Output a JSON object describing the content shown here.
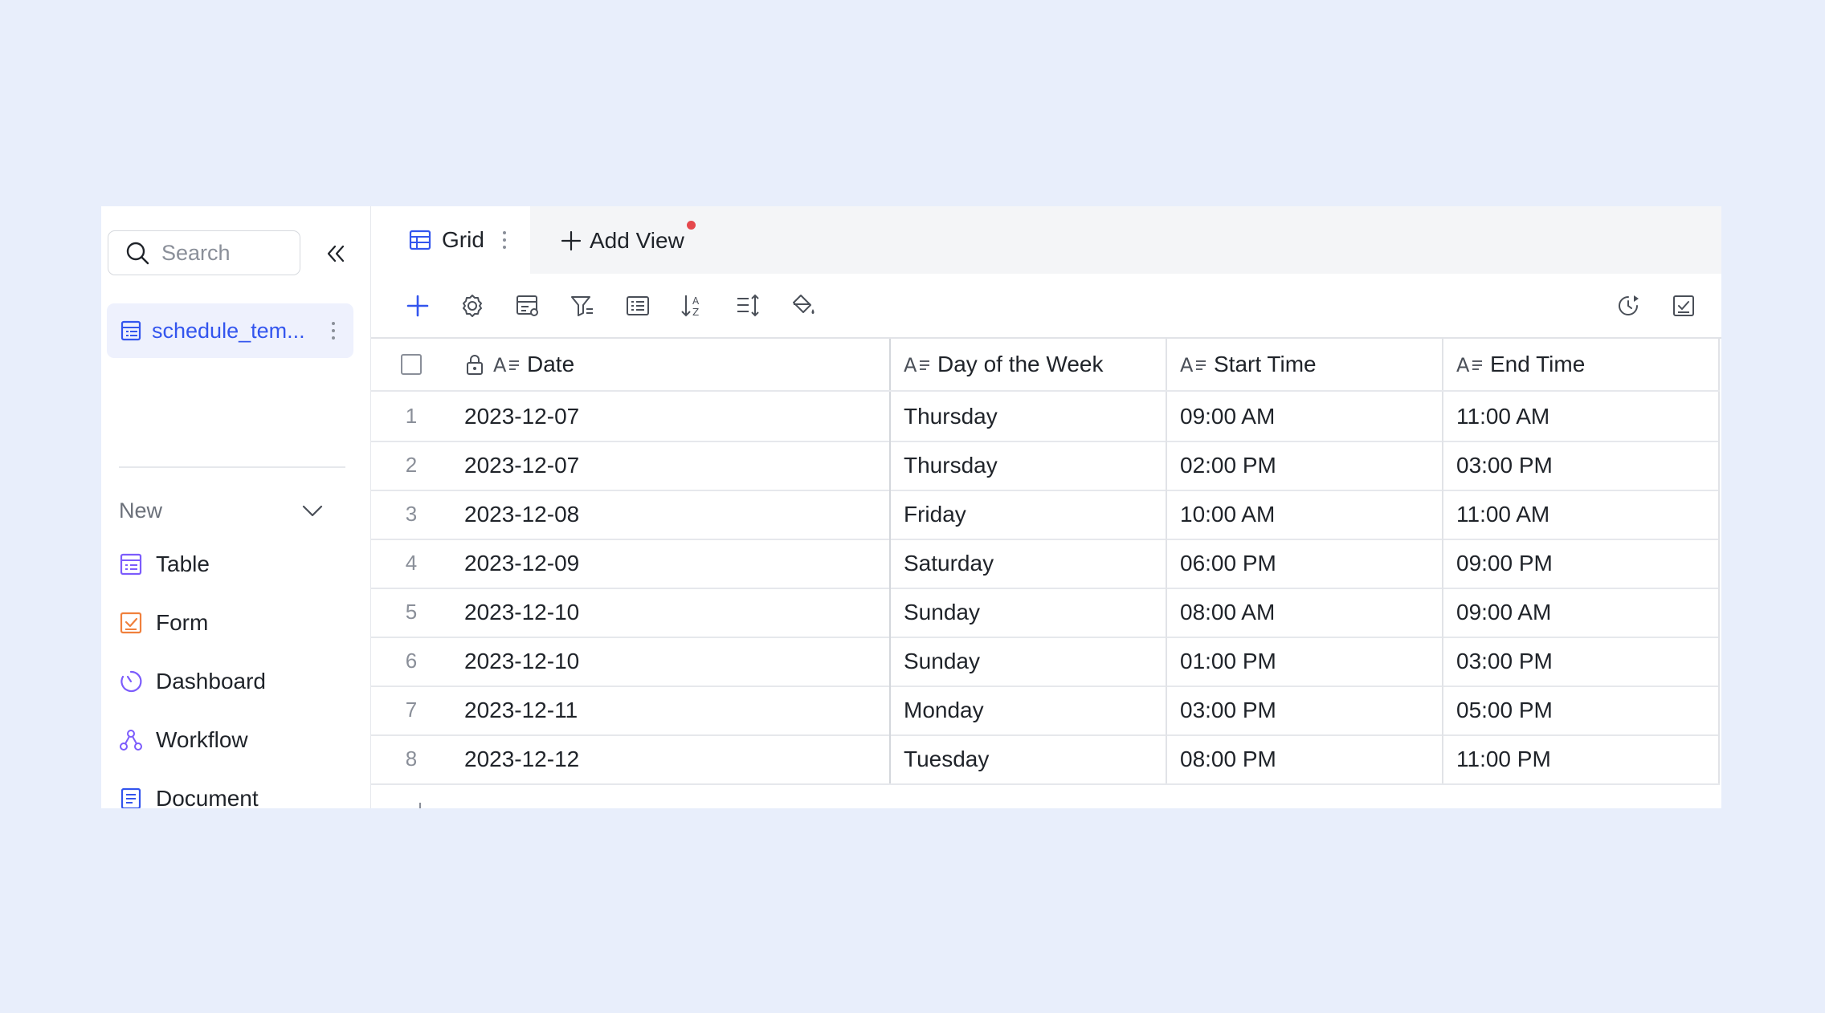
{
  "sidebar": {
    "search_placeholder": "Search",
    "active_table": "schedule_tem...",
    "new_section_label": "New",
    "new_items": [
      {
        "label": "Table",
        "icon": "table-icon",
        "color": "#7c5cfc"
      },
      {
        "label": "Form",
        "icon": "form-icon",
        "color": "#f0803c"
      },
      {
        "label": "Dashboard",
        "icon": "dashboard-icon",
        "color": "#7c5cfc"
      },
      {
        "label": "Workflow",
        "icon": "workflow-icon",
        "color": "#7c5cfc"
      },
      {
        "label": "Document",
        "icon": "document-icon",
        "color": "#3355ee"
      }
    ]
  },
  "views": {
    "active_tab": "Grid",
    "add_view_label": "Add View"
  },
  "toolbar": {
    "buttons": [
      "add-record-icon",
      "settings-icon",
      "field-config-icon",
      "filter-icon",
      "group-icon",
      "sort-icon",
      "row-height-icon",
      "color-fill-icon"
    ],
    "right_buttons": [
      "history-icon",
      "checklist-icon"
    ]
  },
  "table": {
    "columns": [
      "Date",
      "Day of the Week",
      "Start Time",
      "End Time"
    ],
    "rows": [
      {
        "index": "1",
        "date": "2023-12-07",
        "day": "Thursday",
        "start": "09:00 AM",
        "end": "11:00 AM"
      },
      {
        "index": "2",
        "date": "2023-12-07",
        "day": "Thursday",
        "start": "02:00 PM",
        "end": "03:00 PM"
      },
      {
        "index": "3",
        "date": "2023-12-08",
        "day": "Friday",
        "start": "10:00 AM",
        "end": "11:00 AM"
      },
      {
        "index": "4",
        "date": "2023-12-09",
        "day": "Saturday",
        "start": "06:00 PM",
        "end": "09:00 PM"
      },
      {
        "index": "5",
        "date": "2023-12-10",
        "day": "Sunday",
        "start": "08:00 AM",
        "end": "09:00 AM"
      },
      {
        "index": "6",
        "date": "2023-12-10",
        "day": "Sunday",
        "start": "01:00 PM",
        "end": "03:00 PM"
      },
      {
        "index": "7",
        "date": "2023-12-11",
        "day": "Monday",
        "start": "03:00 PM",
        "end": "05:00 PM"
      },
      {
        "index": "8",
        "date": "2023-12-12",
        "day": "Tuesday",
        "start": "08:00 PM",
        "end": "11:00 PM"
      }
    ]
  },
  "colors": {
    "accent": "#3355ee",
    "page_background": "#e8eefb",
    "notification_dot": "#e5484d"
  }
}
